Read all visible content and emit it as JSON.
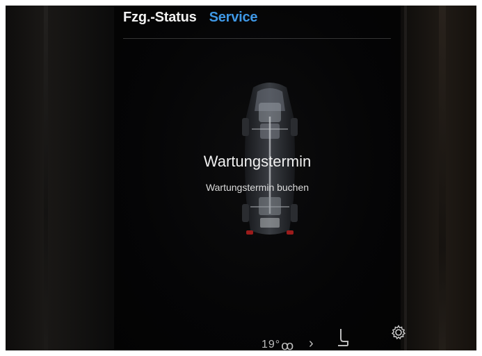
{
  "header": {
    "tabs": [
      {
        "label": "Fzg.-Status",
        "active": false
      },
      {
        "label": "Service",
        "active": true
      }
    ]
  },
  "main": {
    "title": "Wartungstermin",
    "subtitle": "Wartungstermin buchen"
  },
  "bottom_bar": {
    "temperature_partial": "19°",
    "icons": [
      "fan-icon",
      "chevron-right-icon",
      "seat-heating-icon",
      "gear-icon"
    ]
  },
  "colors": {
    "active_tab": "#3f98e6",
    "inactive_tab": "#f2f2f2",
    "screen_background": "#050506"
  }
}
